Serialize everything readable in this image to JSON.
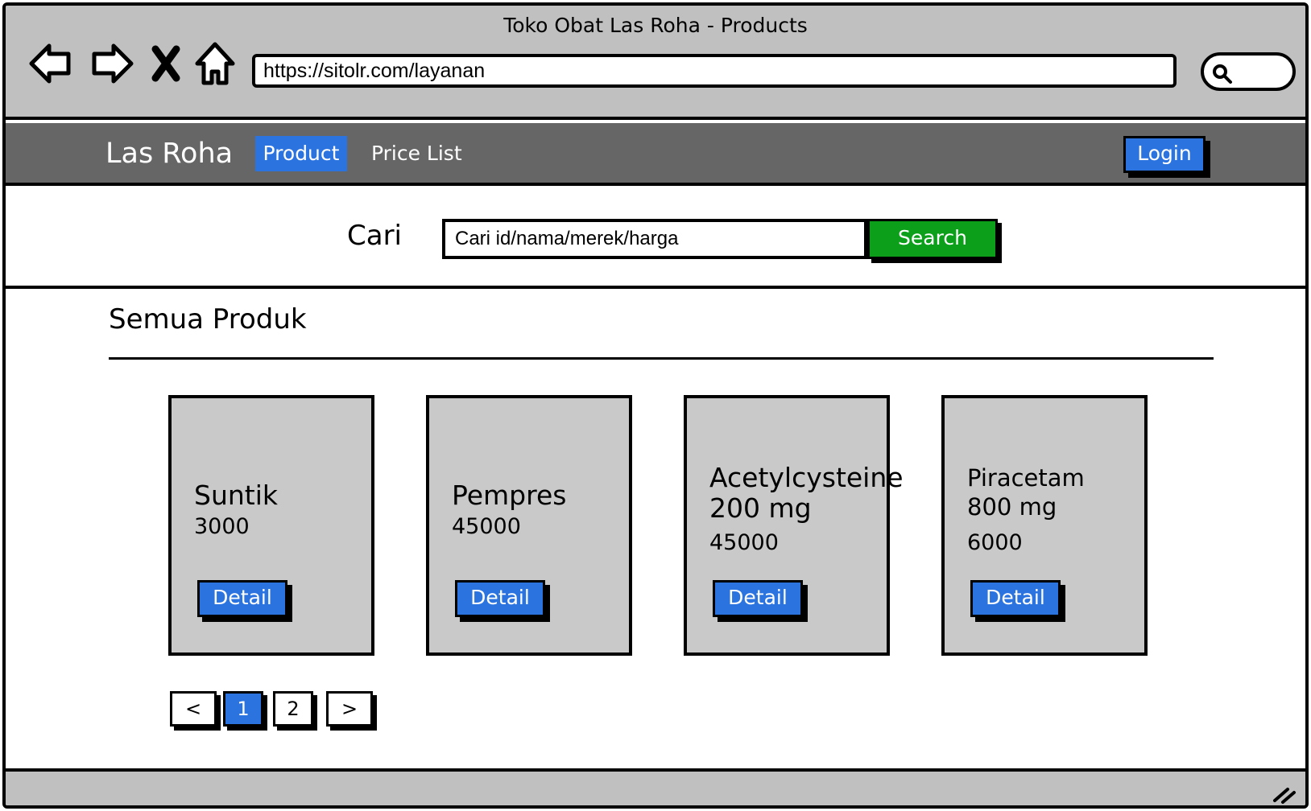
{
  "browser": {
    "window_title": "Toko Obat Las Roha - Products",
    "url": "https://sitolr.com/layanan",
    "icons": [
      "back-icon",
      "forward-icon",
      "stop-icon",
      "home-icon",
      "search-icon",
      "resize-grip-icon"
    ]
  },
  "navbar": {
    "brand": "Las Roha",
    "items": [
      {
        "label": "Product",
        "active": true
      },
      {
        "label": "Price List",
        "active": false
      }
    ],
    "login_label": "Login"
  },
  "search": {
    "label": "Cari",
    "value": "Cari id/nama/merek/harga",
    "button_label": "Search"
  },
  "section": {
    "title": "Semua Produk"
  },
  "products": [
    {
      "name_line1": "Suntik",
      "name_line2": "",
      "price": "3000",
      "button": "Detail"
    },
    {
      "name_line1": "Pempres",
      "name_line2": "",
      "price": "45000",
      "button": "Detail"
    },
    {
      "name_line1": "Acetylcysteine",
      "name_line2": "200 mg",
      "price": "45000",
      "button": "Detail"
    },
    {
      "name_line1": "Piracetam",
      "name_line2": "800 mg",
      "price": "6000",
      "button": "Detail"
    }
  ],
  "pagination": {
    "prev": "<",
    "pages": [
      "1",
      "2"
    ],
    "current": "1",
    "next": ">"
  },
  "colors": {
    "chrome": "#c0c0c0",
    "navbar": "#666666",
    "accent_blue": "#2b74e0",
    "search_green": "#0b9f1a",
    "card": "#c9c9c9"
  }
}
